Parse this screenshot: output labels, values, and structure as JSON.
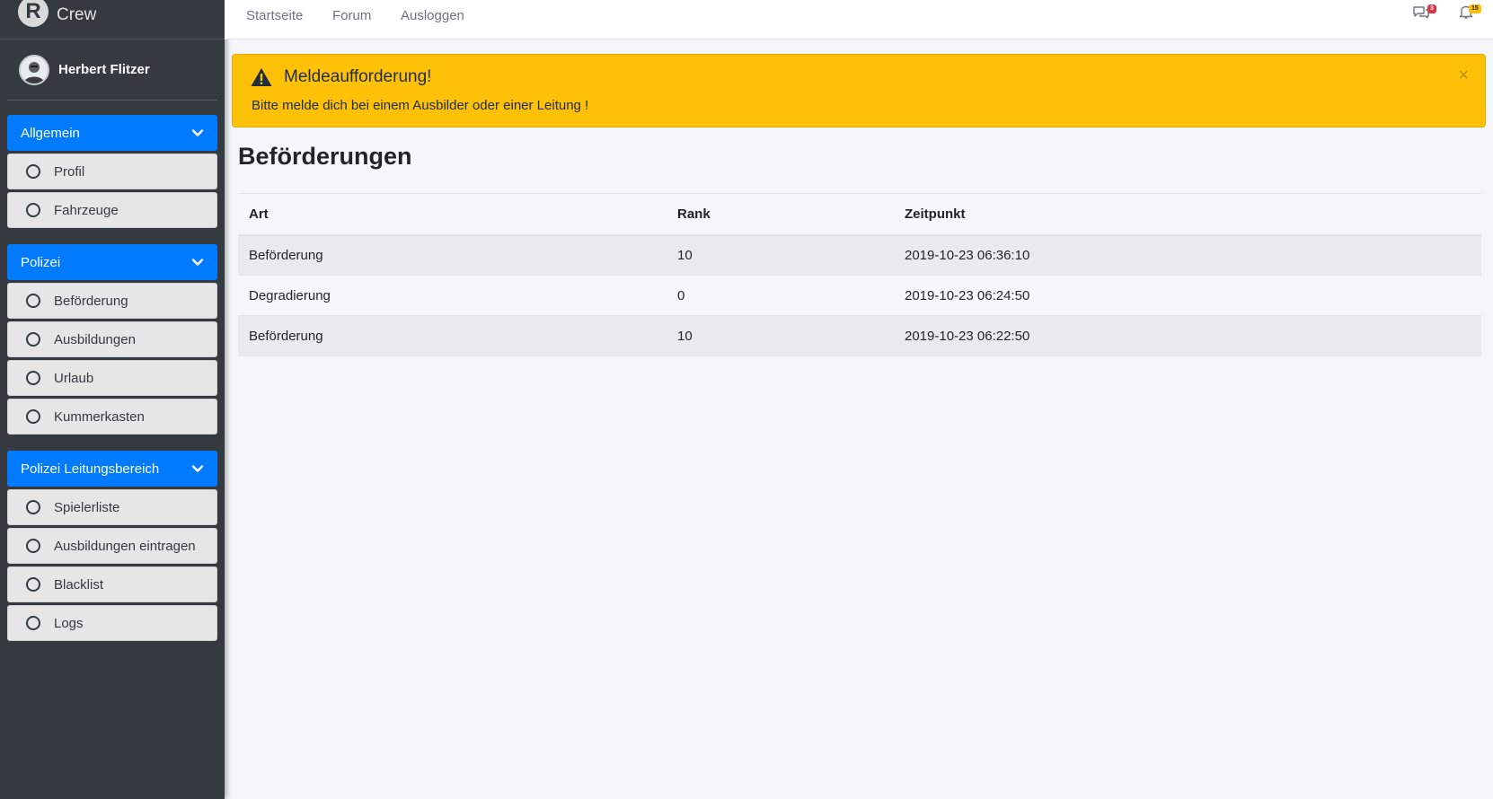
{
  "brand": {
    "logo_letter": "R",
    "name": "Crew"
  },
  "user": {
    "name": "Herbert Flitzer"
  },
  "sidebar": {
    "groups": [
      {
        "label": "Allgemein",
        "items": [
          {
            "label": "Profil"
          },
          {
            "label": "Fahrzeuge"
          }
        ]
      },
      {
        "label": "Polizei",
        "items": [
          {
            "label": "Beförderung"
          },
          {
            "label": "Ausbildungen"
          },
          {
            "label": "Urlaub"
          },
          {
            "label": "Kummerkasten"
          }
        ]
      },
      {
        "label": "Polizei Leitungsbereich",
        "items": [
          {
            "label": "Spielerliste"
          },
          {
            "label": "Ausbildungen eintragen"
          },
          {
            "label": "Blacklist"
          },
          {
            "label": "Logs"
          }
        ]
      }
    ]
  },
  "topnav": {
    "links": [
      {
        "label": "Startseite"
      },
      {
        "label": "Forum"
      },
      {
        "label": "Ausloggen"
      }
    ],
    "messages_badge": "3",
    "notifications_badge": "15"
  },
  "alert": {
    "title": "Meldeaufforderung!",
    "text": "Bitte melde dich bei einem Ausbilder oder einer Leitung !",
    "close": "×"
  },
  "page": {
    "title": "Beförderungen"
  },
  "table": {
    "headers": [
      "Art",
      "Rank",
      "Zeitpunkt"
    ],
    "rows": [
      [
        "Beförderung",
        "10",
        "2019-10-23 06:36:10"
      ],
      [
        "Degradierung",
        "0",
        "2019-10-23 06:24:50"
      ],
      [
        "Beförderung",
        "10",
        "2019-10-23 06:22:50"
      ]
    ]
  },
  "colors": {
    "primary": "#007bff",
    "warning": "#ffc107",
    "sidebar_bg": "#343a40",
    "content_bg": "#f4f6f9"
  }
}
